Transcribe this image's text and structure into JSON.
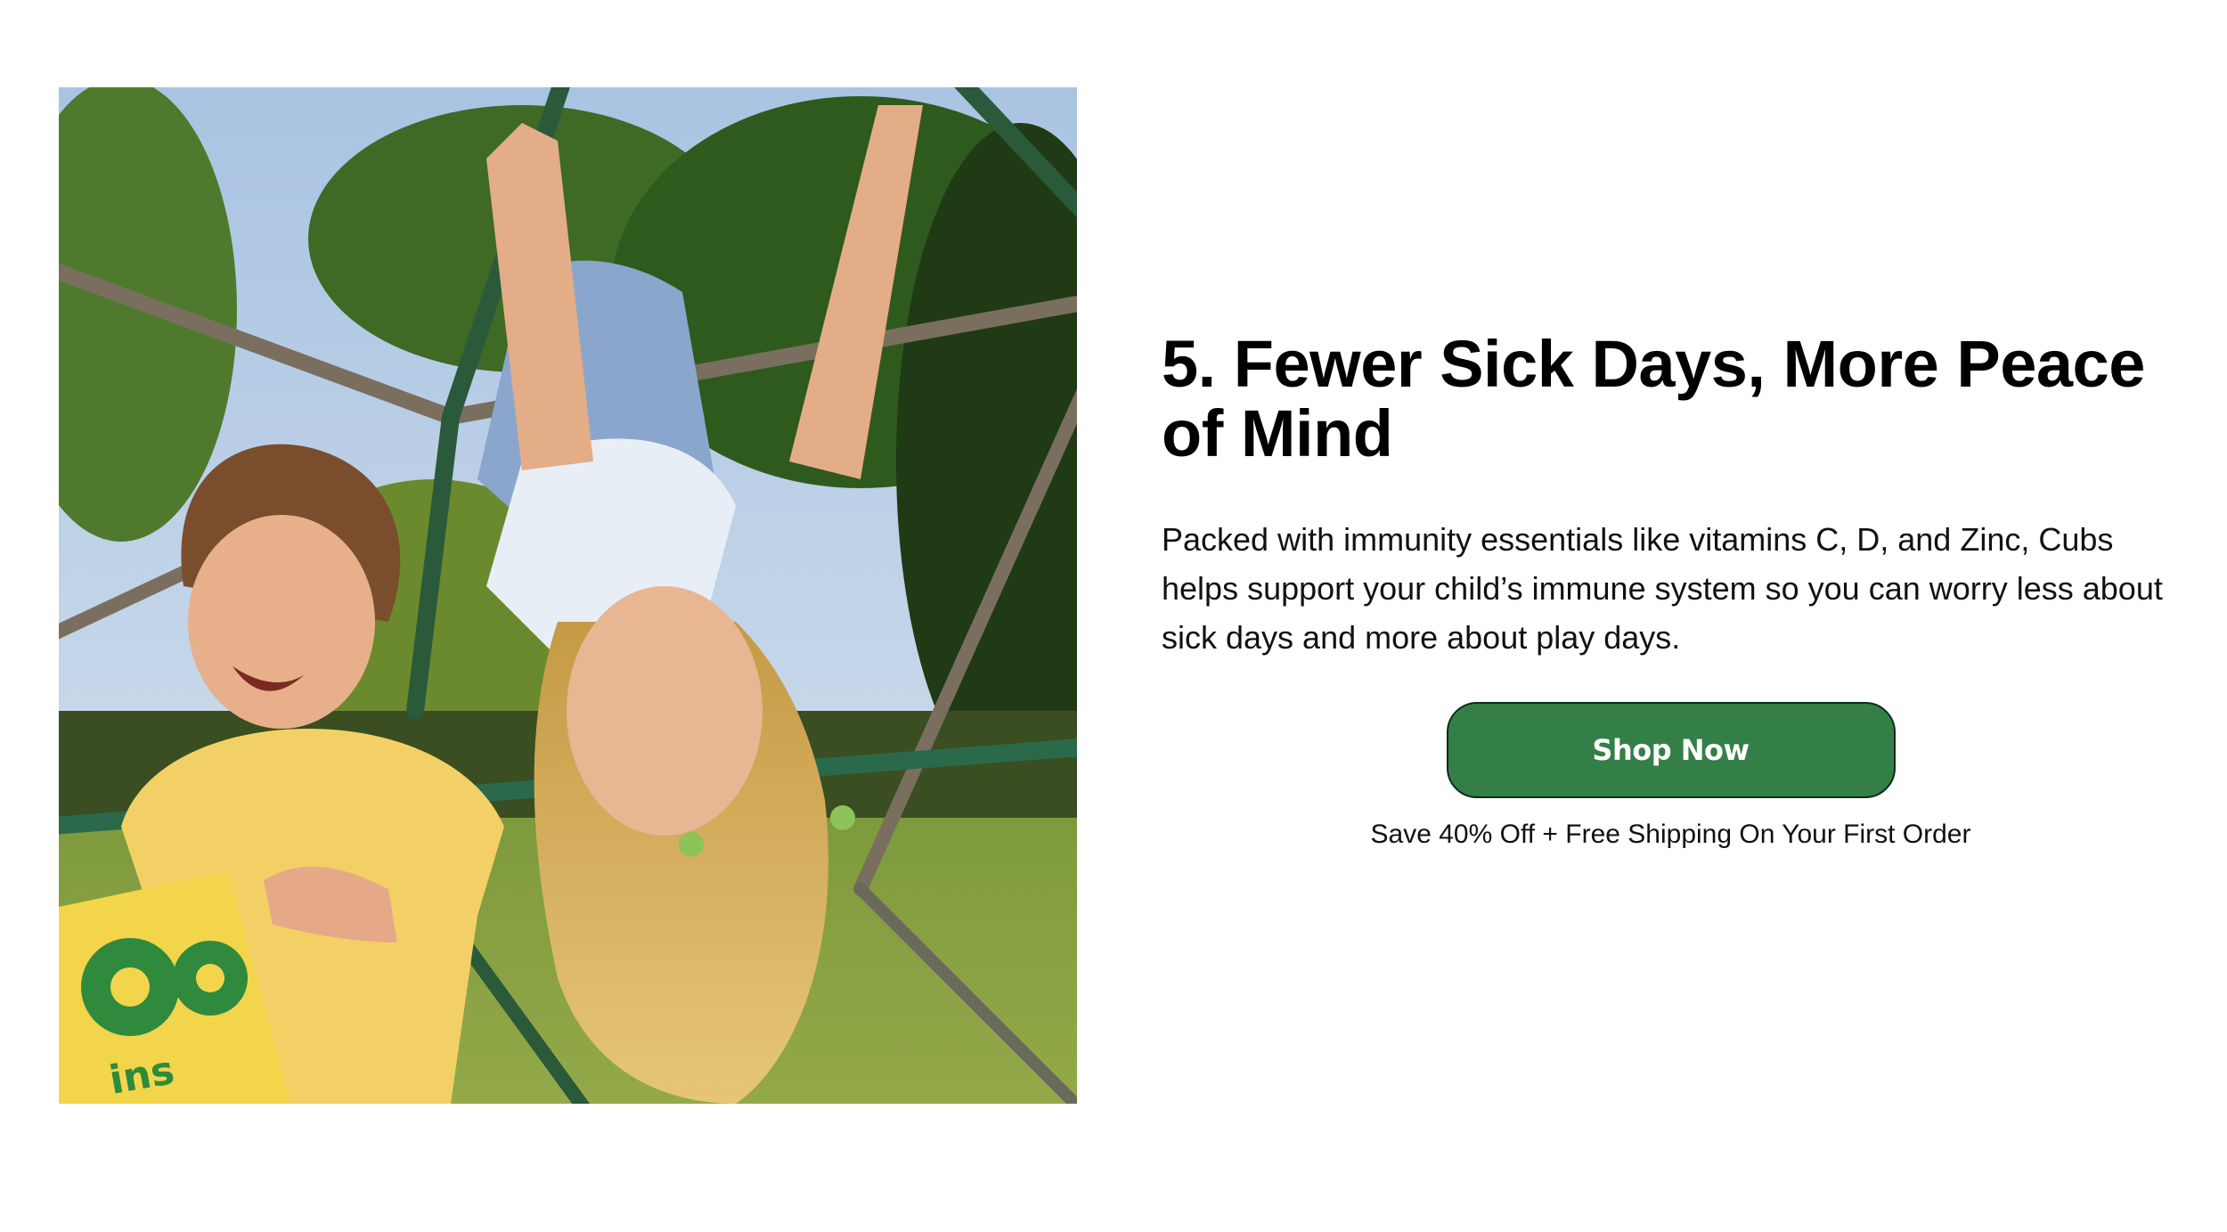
{
  "section": {
    "heading": "5. Fewer Sick Days, More Peace of Mind",
    "body": "Packed with immunity essentials like vitamins C, D, and Zinc, Cubs helps support your child’s immune system so you can worry less about sick days and more about play days.",
    "cta_label": "Shop Now",
    "offer": "Save 40% Off + Free Shipping On Your First Order",
    "photo_bag_text": "ins"
  },
  "colors": {
    "button_bg": "#347f48",
    "button_border": "#0e2c16",
    "button_text": "#ffffff",
    "text": "#000000",
    "background": "#ffffff"
  }
}
